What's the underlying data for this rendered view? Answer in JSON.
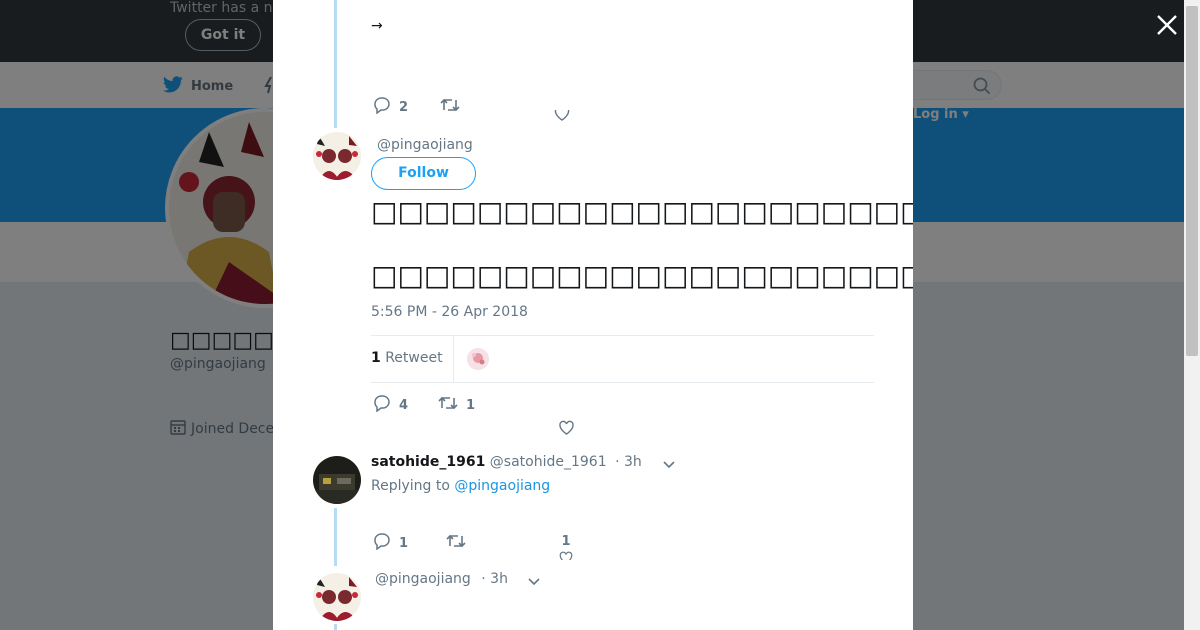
{
  "banner_notice": {
    "text": "Twitter has a n",
    "got_it_label": "Got it"
  },
  "nav": {
    "home_label": "Home",
    "login_label": "Log in ▾"
  },
  "profile": {
    "name": "□□□□□□",
    "handle": "@pingaojiang",
    "joined": "Joined Dece"
  },
  "thread_top": {
    "arrow": "→",
    "reply_count": "2",
    "retweet_count": "",
    "like_count": ""
  },
  "main_tweet": {
    "handle": "@pingaojiang",
    "follow_label": "Follow",
    "text_line1": "□□□□□□□□□□□□□□□□□□□□□□",
    "text_line2": "□□□□□□□□□□□□□□□□□□□□□□□□□□□□□□□□□□□□□",
    "timestamp": "5:56 PM - 26 Apr 2018",
    "retweet_count": "1",
    "retweet_label": "Retweet",
    "actions": {
      "replies": "4",
      "retweets": "1",
      "likes": ""
    }
  },
  "reply_1": {
    "name": "satohide_1961",
    "handle": "@satohide_1961",
    "time": "· 3h",
    "replying_prefix": "Replying to",
    "replying_to": "@pingaojiang",
    "replies": "1",
    "retweets": "",
    "likes": "1"
  },
  "reply_2": {
    "handle": "@pingaojiang",
    "time": "· 3h"
  },
  "colors": {
    "twitter_blue": "#1da1f2",
    "link_blue": "#1b95e0",
    "muted_text": "#657786",
    "topbar": "#33383d"
  }
}
